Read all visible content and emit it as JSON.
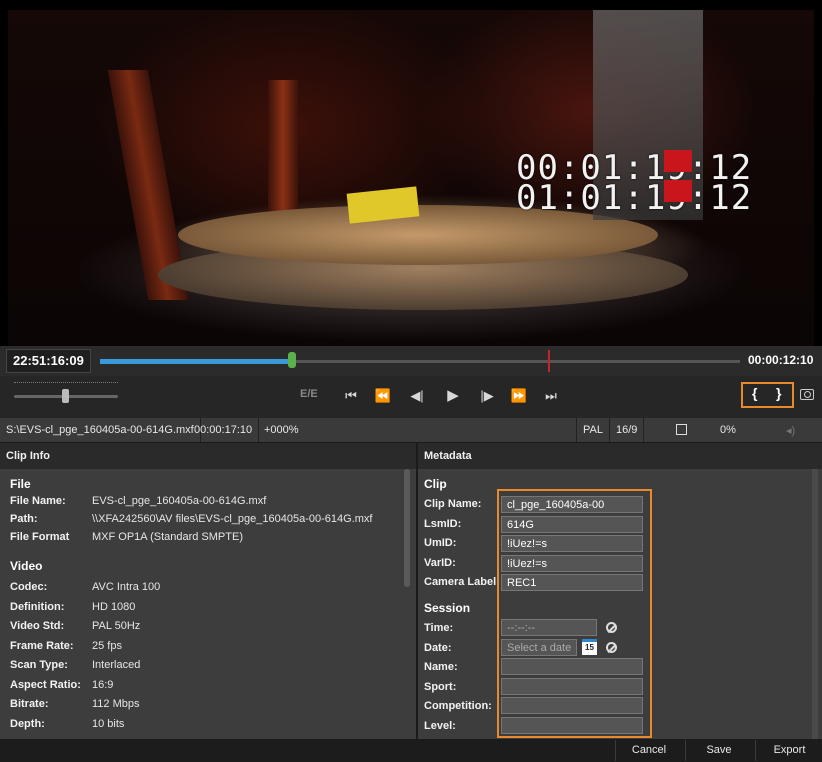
{
  "video": {
    "timecode_top": "00:01:19:12",
    "timecode_bottom": "01:01:19:12"
  },
  "timeline": {
    "current_time": "22:51:16:09",
    "duration": "00:00:12:10",
    "played_fraction": 0.3,
    "mark_fraction": 0.7
  },
  "transport": {
    "ee_label": "E/E",
    "buttons": [
      "⏮",
      "⏪",
      "◀|",
      "▶",
      "|▶",
      "⏩",
      "⏭"
    ],
    "mark_in_icon": "{",
    "mark_out_icon": "}",
    "snapshot_icon": "camera-icon"
  },
  "infobar": {
    "path": "S:\\EVS-cl_pge_160405a-00-614G.mxf",
    "duration": "00:00:17:10",
    "speed": "+000%",
    "standard": "PAL",
    "aspect": "16/9",
    "percent": "0%"
  },
  "clip_info": {
    "header": "Clip Info",
    "file_section": "File",
    "file": [
      {
        "label": "File Name:",
        "value": "EVS-cl_pge_160405a-00-614G.mxf"
      },
      {
        "label": "Path:",
        "value": "\\\\XFA242560\\AV files\\EVS-cl_pge_160405a-00-614G.mxf"
      },
      {
        "label": "File Format",
        "value": "MXF OP1A (Standard SMPTE)"
      }
    ],
    "video_section": "Video",
    "video": [
      {
        "label": "Codec:",
        "value": "AVC Intra 100"
      },
      {
        "label": "Definition:",
        "value": "HD 1080"
      },
      {
        "label": "Video Std:",
        "value": "PAL 50Hz"
      },
      {
        "label": "Frame Rate:",
        "value": "25 fps"
      },
      {
        "label": "Scan Type:",
        "value": "Interlaced"
      },
      {
        "label": "Aspect Ratio:",
        "value": "16:9"
      },
      {
        "label": "Bitrate:",
        "value": "112 Mbps"
      },
      {
        "label": "Depth:",
        "value": "10 bits"
      }
    ]
  },
  "metadata": {
    "header": "Metadata",
    "clip_section": "Clip",
    "clip": [
      {
        "label": "Clip Name:",
        "value": "cl_pge_160405a-00"
      },
      {
        "label": "LsmID:",
        "value": "614G"
      },
      {
        "label": "UmID:",
        "value": "!iUez!=s"
      },
      {
        "label": "VarID:",
        "value": "!iUez!=s"
      },
      {
        "label": "Camera Label:",
        "value": "REC1"
      }
    ],
    "session_section": "Session",
    "time_label": "Time:",
    "time_value": "--:--:--",
    "date_label": "Date:",
    "date_placeholder": "Select a date",
    "calendar_day": "15",
    "session_fields": [
      {
        "label": "Name:",
        "value": ""
      },
      {
        "label": "Sport:",
        "value": ""
      },
      {
        "label": "Competition:",
        "value": ""
      },
      {
        "label": "Level:",
        "value": ""
      }
    ]
  },
  "actions": {
    "cancel": "Cancel",
    "save": "Save",
    "export": "Export"
  },
  "colors": {
    "accent": "#e88a2c",
    "timeline_played": "#3a9ad9",
    "marker": "#5bb04a",
    "mark_out": "#c0262b"
  }
}
